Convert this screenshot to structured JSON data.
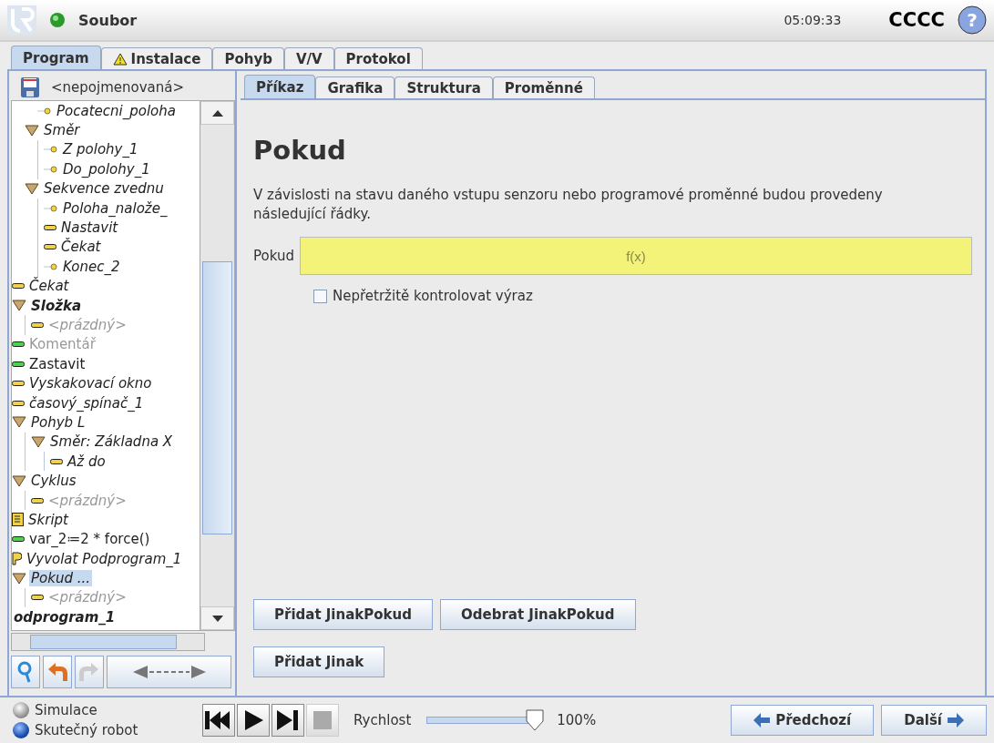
{
  "header": {
    "menu": "Soubor",
    "time": "05:09:33",
    "robot_name": "CCCC",
    "help": "?"
  },
  "main_tabs": [
    {
      "label": "Program",
      "selected": true,
      "warning": false
    },
    {
      "label": "Instalace",
      "selected": false,
      "warning": true
    },
    {
      "label": "Pohyb",
      "selected": false,
      "warning": false
    },
    {
      "label": "V/V",
      "selected": false,
      "warning": false
    },
    {
      "label": "Protokol",
      "selected": false,
      "warning": false
    }
  ],
  "program_name": "<nepojmenovaná>",
  "tree": [
    {
      "children": [
        {
          "children": [
            {
              "label": "Pocatecni_poloha",
              "kind": "point",
              "italic": true,
              "bold": false,
              "dim": false,
              "selected": false
            }
          ]
        },
        {
          "label": "Směr",
          "kind": "folder",
          "italic": true,
          "bold": false,
          "dim": false,
          "selected": false,
          "children": [
            {
              "label": "Z polohy_1",
              "kind": "point",
              "italic": true,
              "bold": false,
              "dim": false,
              "selected": false
            },
            {
              "label": "Do_polohy_1",
              "kind": "point",
              "italic": true,
              "bold": false,
              "dim": false,
              "selected": false
            }
          ]
        },
        {
          "label": "Sekvence zvednu",
          "kind": "folder",
          "italic": true,
          "bold": false,
          "dim": false,
          "selected": false,
          "children": [
            {
              "label": "Poloha_nalože_",
              "kind": "point",
              "italic": true,
              "bold": false,
              "dim": false,
              "selected": false
            },
            {
              "label": "Nastavit",
              "kind": "bar",
              "italic": true,
              "bold": false,
              "dim": false,
              "selected": false
            },
            {
              "label": "Čekat",
              "kind": "bar",
              "italic": true,
              "bold": false,
              "dim": false,
              "selected": false
            },
            {
              "label": "Konec_2",
              "kind": "point",
              "italic": true,
              "bold": false,
              "dim": false,
              "selected": false
            }
          ]
        }
      ]
    },
    {
      "label": "Čekat",
      "kind": "bar",
      "italic": true,
      "bold": false,
      "dim": false,
      "selected": false
    },
    {
      "label": "Složka",
      "kind": "folder",
      "italic": true,
      "bold": true,
      "dim": false,
      "selected": false,
      "children": [
        {
          "label": "<prázdný>",
          "kind": "bar",
          "italic": true,
          "bold": false,
          "dim": true,
          "selected": false
        }
      ]
    },
    {
      "label": "Komentář",
      "kind": "green",
      "italic": false,
      "bold": false,
      "dim": true,
      "selected": false
    },
    {
      "label": "Zastavit",
      "kind": "green",
      "italic": false,
      "bold": false,
      "dim": false,
      "selected": false
    },
    {
      "label": "Vyskakovací okno",
      "kind": "bar",
      "italic": true,
      "bold": false,
      "dim": false,
      "selected": false
    },
    {
      "label": "časový_spínač_1",
      "kind": "bar",
      "italic": true,
      "bold": false,
      "dim": false,
      "selected": false
    },
    {
      "label": "Pohyb L",
      "kind": "folder",
      "italic": true,
      "bold": false,
      "dim": false,
      "selected": false,
      "children": [
        {
          "label": "Směr: Základna X",
          "kind": "folder",
          "italic": true,
          "bold": false,
          "dim": false,
          "selected": false,
          "children": [
            {
              "label": "Až do",
              "kind": "bar",
              "italic": true,
              "bold": false,
              "dim": false,
              "selected": false
            }
          ]
        }
      ]
    },
    {
      "label": "Cyklus",
      "kind": "folder",
      "italic": true,
      "bold": false,
      "dim": false,
      "selected": false,
      "children": [
        {
          "label": "<prázdný>",
          "kind": "bar",
          "italic": true,
          "bold": false,
          "dim": true,
          "selected": false
        }
      ]
    },
    {
      "label": "Skript",
      "kind": "script",
      "italic": true,
      "bold": false,
      "dim": false,
      "selected": false
    },
    {
      "label": "var_2≔2 * force()",
      "kind": "green",
      "italic": false,
      "bold": false,
      "dim": false,
      "selected": false
    },
    {
      "label": "Vyvolat Podprogram_1",
      "kind": "call",
      "italic": true,
      "bold": false,
      "dim": false,
      "selected": false
    },
    {
      "label": "Pokud ...",
      "kind": "folder",
      "italic": true,
      "bold": false,
      "dim": false,
      "selected": true,
      "children": [
        {
          "label": "<prázdný>",
          "kind": "bar",
          "italic": true,
          "bold": false,
          "dim": true,
          "selected": false
        }
      ]
    },
    {
      "label": "odprogram_1",
      "kind": "none",
      "italic": true,
      "bold": true,
      "dim": false,
      "selected": false
    }
  ],
  "sub_tabs": [
    {
      "label": "Příkaz",
      "selected": true
    },
    {
      "label": "Grafika",
      "selected": false
    },
    {
      "label": "Struktura",
      "selected": false
    },
    {
      "label": "Proměnné",
      "selected": false
    }
  ],
  "command": {
    "title": "Pokud",
    "description": "V závislosti na stavu daného vstupu senzoru nebo programové proměnné budou provedeny následující řádky.",
    "field_label": "Pokud",
    "field_placeholder": "f(x)",
    "checkbox": {
      "label": "Nepřetržitě kontrolovat výraz",
      "checked": false
    },
    "buttons": [
      [
        "Přidat JinakPokud",
        "Odebrat JinakPokud"
      ],
      [
        "Přidat Jinak"
      ]
    ]
  },
  "modes": [
    {
      "label": "Simulace",
      "selected": false
    },
    {
      "label": "Skutečný robot",
      "selected": true
    }
  ],
  "speed": {
    "label": "Rychlost",
    "level": 0.97,
    "reading": "100%"
  },
  "nav": {
    "previous": "Předchozí",
    "next": "Další"
  }
}
